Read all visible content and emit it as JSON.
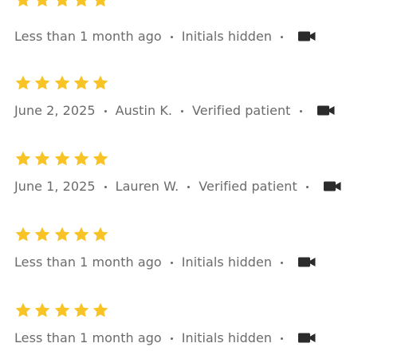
{
  "colors": {
    "star": "#F7C325",
    "meta_text": "#6b6b6b",
    "icon": "#2b2b2b"
  },
  "reviews": [
    {
      "rating": 5,
      "date": "Less than 1 month ago",
      "author": "Initials hidden",
      "status": "",
      "media_icon": "video-camera-icon"
    },
    {
      "rating": 5,
      "date": "June 2, 2025",
      "author": "Austin K.",
      "status": "Verified patient",
      "media_icon": "video-camera-icon"
    },
    {
      "rating": 5,
      "date": "June 1, 2025",
      "author": "Lauren W.",
      "status": "Verified patient",
      "media_icon": "video-camera-icon"
    },
    {
      "rating": 5,
      "date": "Less than 1 month ago",
      "author": "Initials hidden",
      "status": "",
      "media_icon": "video-camera-icon"
    },
    {
      "rating": 5,
      "date": "Less than 1 month ago",
      "author": "Initials hidden",
      "status": "",
      "media_icon": "video-camera-icon"
    }
  ]
}
